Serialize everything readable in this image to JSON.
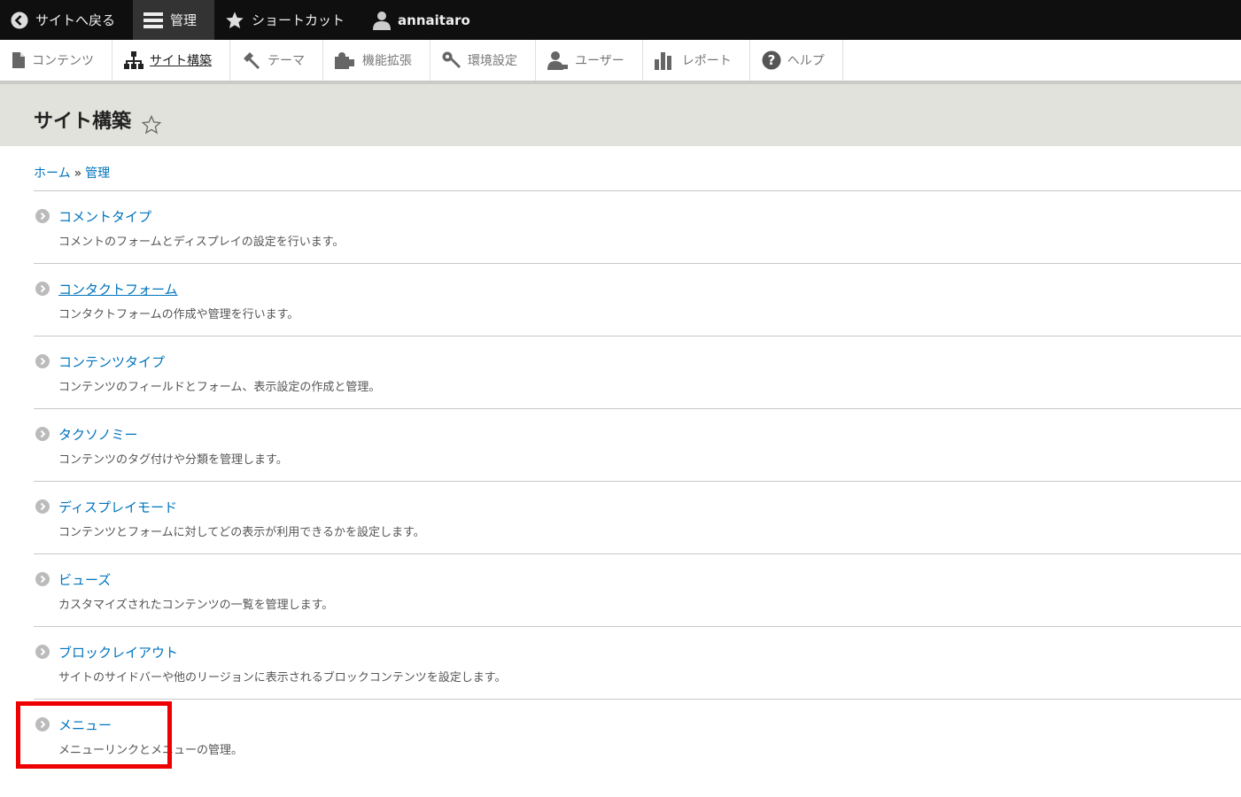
{
  "toolbar": {
    "items": [
      {
        "label": "サイトへ戻る",
        "icon": "back-arrow-icon"
      },
      {
        "label": "管理",
        "icon": "hamburger-menu-icon"
      },
      {
        "label": "ショートカット",
        "icon": "star-icon"
      },
      {
        "label": "annaitaro",
        "icon": "user-icon"
      }
    ]
  },
  "tray": {
    "items": [
      {
        "label": "コンテンツ",
        "icon": "document-icon"
      },
      {
        "label": "サイト構築",
        "icon": "sitemap-icon"
      },
      {
        "label": "テーマ",
        "icon": "brush-icon"
      },
      {
        "label": "機能拡張",
        "icon": "puzzle-icon"
      },
      {
        "label": "環境設定",
        "icon": "wrench-icon"
      },
      {
        "label": "ユーザー",
        "icon": "people-icon"
      },
      {
        "label": "レポート",
        "icon": "bar-chart-icon"
      },
      {
        "label": "ヘルプ",
        "icon": "help-icon"
      }
    ]
  },
  "page": {
    "title": "サイト構築"
  },
  "breadcrumb": {
    "home": "ホーム",
    "separator": "»",
    "current": "管理"
  },
  "items": [
    {
      "title": "コメントタイプ",
      "description": "コメントのフォームとディスプレイの設定を行います。"
    },
    {
      "title": "コンタクトフォーム",
      "description": "コンタクトフォームの作成や管理を行います。"
    },
    {
      "title": "コンテンツタイプ",
      "description": "コンテンツのフィールドとフォーム、表示設定の作成と管理。"
    },
    {
      "title": "タクソノミー",
      "description": "コンテンツのタグ付けや分類を管理します。"
    },
    {
      "title": "ディスプレイモード",
      "description": "コンテンツとフォームに対してどの表示が利用できるかを設定します。"
    },
    {
      "title": "ビューズ",
      "description": "カスタマイズされたコンテンツの一覧を管理します。"
    },
    {
      "title": "ブロックレイアウト",
      "description": "サイトのサイドバーや他のリージョンに表示されるブロックコンテンツを設定します。"
    },
    {
      "title": "メニュー",
      "description": "メニューリンクとメニューの管理。"
    }
  ],
  "colors": {
    "link": "#0074bd",
    "toolbar_bg": "#0f0f0f",
    "header_bg": "#e1e2dc",
    "highlight": "#ee0000"
  }
}
